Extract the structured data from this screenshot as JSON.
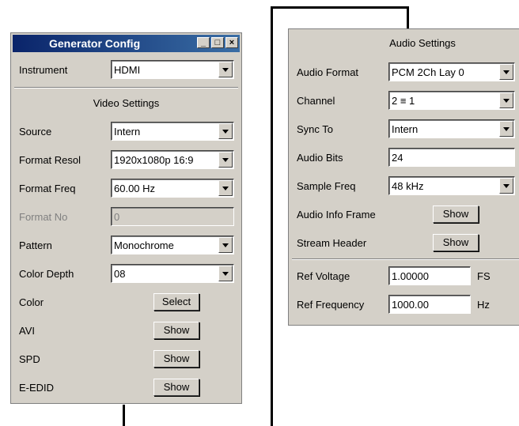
{
  "generator": {
    "title": "Generator Config",
    "window_buttons": [
      "_",
      "□",
      "×"
    ],
    "instrument_label": "Instrument",
    "instrument_value": "HDMI",
    "section_title": "Video Settings",
    "rows": [
      {
        "label": "Source",
        "value": "Intern"
      },
      {
        "label": "Format Resol",
        "value": "1920x1080p 16:9"
      },
      {
        "label": "Format Freq",
        "value": "60.00 Hz"
      },
      {
        "label": "Format No",
        "value": "0"
      },
      {
        "label": "Pattern",
        "value": "Monochrome"
      },
      {
        "label": "Color Depth",
        "value": "08"
      }
    ],
    "buttons": [
      {
        "label": "Color",
        "button": "Select"
      },
      {
        "label": "AVI",
        "button": "Show"
      },
      {
        "label": "SPD",
        "button": "Show"
      },
      {
        "label": "E-EDID",
        "button": "Show"
      }
    ]
  },
  "audio": {
    "section_title": "Audio Settings",
    "rows": [
      {
        "label": "Audio Format",
        "value": "PCM 2Ch Lay 0"
      },
      {
        "label": "Channel",
        "value": "2 ≡ 1"
      },
      {
        "label": "Sync To",
        "value": "Intern"
      },
      {
        "label": "Audio Bits",
        "value": "24"
      },
      {
        "label": "Sample Freq",
        "value": "48 kHz"
      }
    ],
    "buttons": [
      {
        "label": "Audio Info Frame",
        "button": "Show"
      },
      {
        "label": "Stream Header",
        "button": "Show"
      }
    ],
    "ref": [
      {
        "label": "Ref Voltage",
        "value": "1.00000",
        "unit": "FS"
      },
      {
        "label": "Ref Frequency",
        "value": "1000.00",
        "unit": "Hz"
      }
    ]
  }
}
